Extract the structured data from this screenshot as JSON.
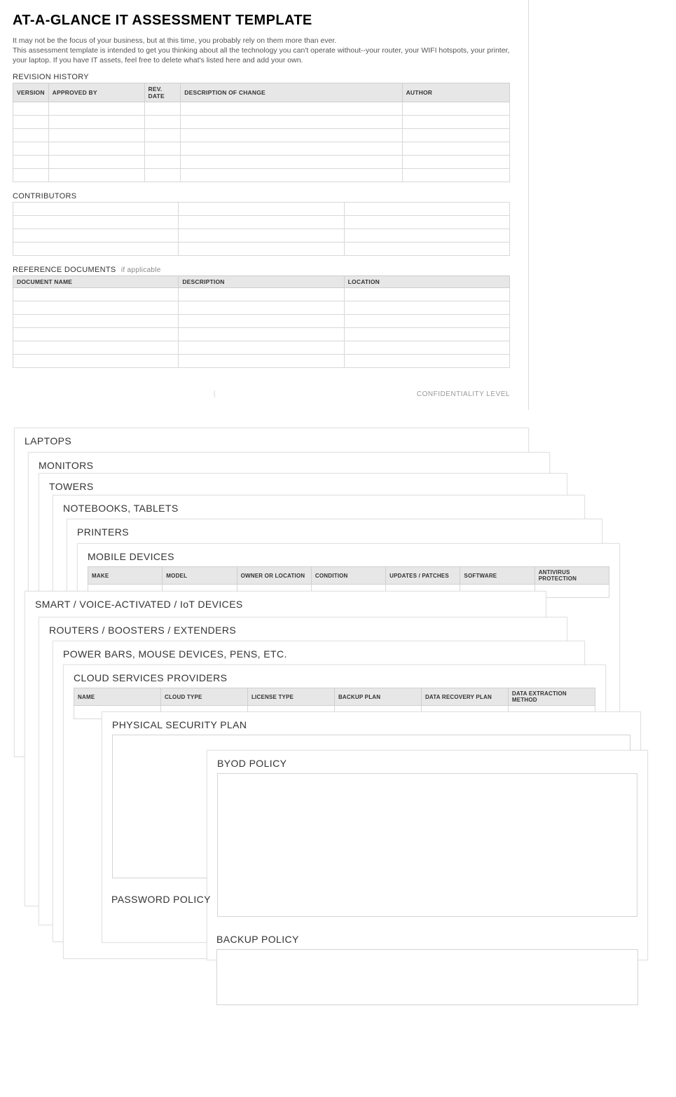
{
  "title": "AT-A-GLANCE IT ASSESSMENT TEMPLATE",
  "intro_line1": "It may not be the focus of your business, but at this time, you probably rely on them more than ever.",
  "intro_line2": "This assessment template is intended to get you thinking about all the technology you can't operate without--your router, your WIFI hotspots, your printer, your laptop. If you have IT assets, feel free to delete what's listed here and add your own.",
  "revision": {
    "label": "REVISION HISTORY",
    "headers": [
      "VERSION",
      "APPROVED BY",
      "REV. DATE",
      "DESCRIPTION OF CHANGE",
      "AUTHOR"
    ],
    "rows": 6
  },
  "contributors": {
    "label": "CONTRIBUTORS",
    "rows": 4,
    "cols": 3
  },
  "refdocs": {
    "label": "REFERENCE DOCUMENTS",
    "sublabel": "if applicable",
    "headers": [
      "DOCUMENT NAME",
      "DESCRIPTION",
      "LOCATION"
    ],
    "rows": 6
  },
  "footer": {
    "center": "|",
    "right": "CONFIDENTIALITY LEVEL"
  },
  "sheets": {
    "laptops": "LAPTOPS",
    "monitors": "MONITORS",
    "towers": "TOWERS",
    "notebooks": "NOTEBOOKS, TABLETS",
    "printers": "PRINTERS",
    "mobile": {
      "title": "MOBILE DEVICES",
      "headers": [
        "MAKE",
        "MODEL",
        "OWNER OR LOCATION",
        "CONDITION",
        "UPDATES / PATCHES",
        "SOFTWARE",
        "ANTIVIRUS PROTECTION"
      ]
    },
    "smart": "SMART / VOICE-ACTIVATED / IoT DEVICES",
    "routers": "ROUTERS / BOOSTERS / EXTENDERS",
    "power": "POWER BARS, MOUSE DEVICES, PENS, ETC.",
    "cloud": {
      "title": "CLOUD SERVICES PROVIDERS",
      "headers": [
        "NAME",
        "CLOUD TYPE",
        "LICENSE TYPE",
        "BACKUP PLAN",
        "DATA RECOVERY PLAN",
        "DATA EXTRACTION METHOD"
      ]
    },
    "physical": "PHYSICAL SECURITY PLAN",
    "byod": "BYOD POLICY",
    "password": "PASSWORD POLICY",
    "backup": "BACKUP POLICY"
  }
}
